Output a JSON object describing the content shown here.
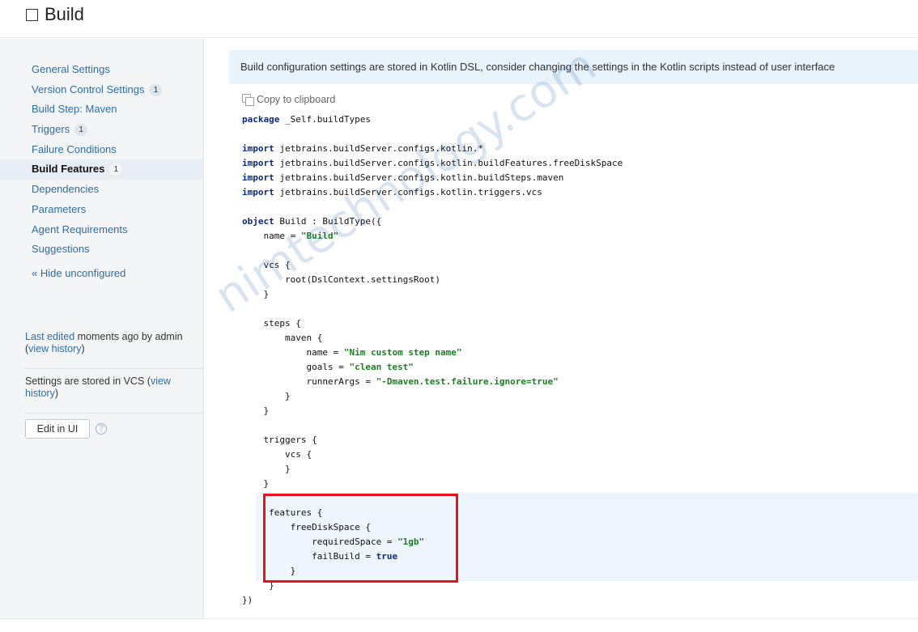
{
  "header": {
    "title": "Build"
  },
  "sidebar": {
    "items": [
      {
        "label": "General Settings",
        "badge": ""
      },
      {
        "label": "Version Control Settings",
        "badge": "1"
      },
      {
        "label": "Build Step: Maven",
        "badge": ""
      },
      {
        "label": "Triggers",
        "badge": "1"
      },
      {
        "label": "Failure Conditions",
        "badge": ""
      },
      {
        "label": "Build Features",
        "badge": "1",
        "active": true
      },
      {
        "label": "Dependencies",
        "badge": ""
      },
      {
        "label": "Parameters",
        "badge": ""
      },
      {
        "label": "Agent Requirements",
        "badge": ""
      },
      {
        "label": "Suggestions",
        "badge": ""
      }
    ],
    "hide_unconfigured": "« Hide unconfigured",
    "last_edited_link": "Last edited",
    "last_edited_text": " moments ago by admin",
    "view_history_1": "view history",
    "vcs_text": "Settings are stored in VCS (",
    "view_history_2": "view history",
    "edit_button": "Edit in UI",
    "help_icon": "?"
  },
  "main": {
    "info": "Build configuration settings are stored in Kotlin DSL, consider changing the settings in the Kotlin scripts instead of user interface",
    "copy_label": "Copy to clipboard"
  },
  "watermark": "nimtechnology.com",
  "code_lines": [
    [
      [
        "kw",
        "package"
      ],
      [
        "t",
        " _Self.buildTypes"
      ]
    ],
    [],
    [
      [
        "kw",
        "import"
      ],
      [
        "t",
        " jetbrains.buildServer.configs.kotlin.*"
      ]
    ],
    [
      [
        "kw",
        "import"
      ],
      [
        "t",
        " jetbrains.buildServer.configs.kotlin.buildFeatures.freeDiskSpace"
      ]
    ],
    [
      [
        "kw",
        "import"
      ],
      [
        "t",
        " jetbrains.buildServer.configs.kotlin.buildSteps.maven"
      ]
    ],
    [
      [
        "kw",
        "import"
      ],
      [
        "t",
        " jetbrains.buildServer.configs.kotlin.triggers.vcs"
      ]
    ],
    [],
    [
      [
        "kw",
        "object"
      ],
      [
        "t",
        " Build : BuildType({"
      ]
    ],
    [
      [
        "t",
        "    name = "
      ],
      [
        "str",
        "\"Build\""
      ]
    ],
    [],
    [
      [
        "t",
        "    vcs {"
      ]
    ],
    [
      [
        "t",
        "        root(DslContext.settingsRoot)"
      ]
    ],
    [
      [
        "t",
        "    }"
      ]
    ],
    [],
    [
      [
        "t",
        "    steps {"
      ]
    ],
    [
      [
        "t",
        "        maven {"
      ]
    ],
    [
      [
        "t",
        "            name = "
      ],
      [
        "str",
        "\"Nim custom step name\""
      ]
    ],
    [
      [
        "t",
        "            goals = "
      ],
      [
        "str",
        "\"clean test\""
      ]
    ],
    [
      [
        "t",
        "            runnerArgs = "
      ],
      [
        "str",
        "\"-Dmaven.test.failure.ignore=true\""
      ]
    ],
    [
      [
        "t",
        "        }"
      ]
    ],
    [
      [
        "t",
        "    }"
      ]
    ],
    [],
    [
      [
        "t",
        "    triggers {"
      ]
    ],
    [
      [
        "t",
        "        vcs {"
      ]
    ],
    [
      [
        "t",
        "        }"
      ]
    ],
    [
      [
        "t",
        "    }"
      ]
    ],
    [],
    [
      [
        "t",
        "     features {"
      ]
    ],
    [
      [
        "t",
        "         freeDiskSpace {"
      ]
    ],
    [
      [
        "t",
        "             requiredSpace = "
      ],
      [
        "str",
        "\"1gb\""
      ]
    ],
    [
      [
        "t",
        "             failBuild = "
      ],
      [
        "kw",
        "true"
      ]
    ],
    [
      [
        "t",
        "         }"
      ]
    ],
    [
      [
        "t",
        "     }"
      ]
    ],
    [
      [
        "t",
        "})"
      ]
    ]
  ]
}
